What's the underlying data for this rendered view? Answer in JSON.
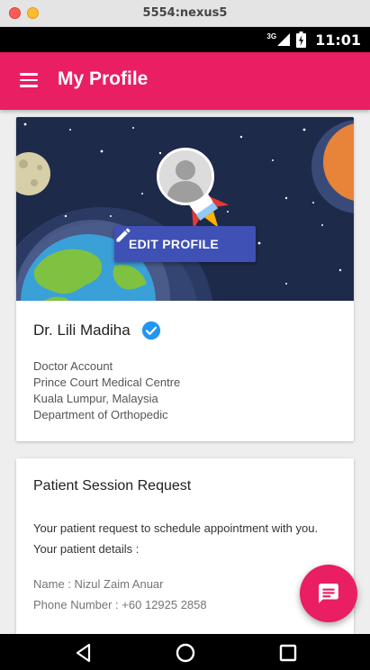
{
  "window": {
    "title": "5554:nexus5"
  },
  "status_bar": {
    "network": "3G",
    "time": "11:01"
  },
  "app_bar": {
    "title": "My Profile"
  },
  "profile_card": {
    "edit_button_label": "EDIT PROFILE",
    "name": "Dr. Lili Madiha",
    "details": [
      "Doctor Account",
      "Prince Court Medical Centre",
      "Kuala Lumpur, Malaysia",
      "Department of Orthopedic"
    ]
  },
  "request_card": {
    "title": "Patient Session Request",
    "body_line1": "Your patient request to schedule appointment with you.",
    "body_line2": "Your patient details :",
    "patient_name": "Name : Nizul Zaim Anuar",
    "patient_phone": "Phone Number : +60 12925 2858"
  },
  "colors": {
    "primary": "#e91e63",
    "accent": "#3f51b5",
    "verified": "#2196f3",
    "hero_bg": "#1e2a4a"
  },
  "icons": [
    "menu-icon",
    "avatar-icon",
    "pencil-icon",
    "verified-icon",
    "message-icon",
    "back-icon",
    "home-icon",
    "recents-icon"
  ]
}
